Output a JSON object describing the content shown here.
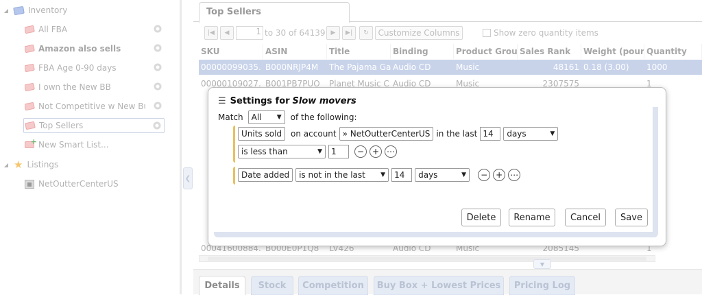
{
  "sidebar": {
    "inventory_label": "Inventory",
    "items": [
      {
        "label": "All FBA"
      },
      {
        "label": "Amazon also sells"
      },
      {
        "label": "FBA Age 0-90 days"
      },
      {
        "label": "I own the New BB"
      },
      {
        "label": "Not Competitive w New Bu"
      },
      {
        "label": "Top Sellers"
      }
    ],
    "new_smart_list": "New Smart List...",
    "listings_label": "Listings",
    "account_item": "NetOutterCenterUS"
  },
  "main": {
    "tab_title": "Top Sellers",
    "pager": {
      "page": "1",
      "range_text": "to 30 of 64139"
    },
    "customize_label": "Customize Columns",
    "show_zero_label": "Show zero quantity items",
    "columns": [
      "SKU",
      "ASIN",
      "Title",
      "Binding",
      "Product Grou",
      "Sales Rank",
      "Weight (pour",
      "Quantity"
    ],
    "rows": [
      {
        "sku": "00000099035.",
        "asin": "B000NRJP4M",
        "title": "The Pajama Ga",
        "binding": "Audio CD",
        "group": "Music",
        "rank": "48161",
        "weight": "0.18 (3.00)",
        "qty": "1000"
      },
      {
        "sku": "00000109027.",
        "asin": "B001PB7PUO",
        "title": "Planet Music C",
        "binding": "Audio CD",
        "group": "Music",
        "rank": "2307575",
        "weight": "",
        "qty": "1"
      },
      {
        "sku": "00041600884.",
        "asin": "B000E0P1Q8",
        "title": "LV426",
        "binding": "Audio CD",
        "group": "Music",
        "rank": "2085145",
        "weight": "",
        "qty": "1"
      }
    ]
  },
  "bottom_tabs": [
    "Details",
    "Stock",
    "Competition",
    "Buy Box + Lowest Prices",
    "Pricing Log"
  ],
  "dialog": {
    "title_prefix": "Settings for",
    "list_name": "Slow movers",
    "match_label": "Match",
    "match_value": "All",
    "of_following": "of the following:",
    "condition1": {
      "field": "Units sold",
      "on_account": "on account",
      "account": "» NetOutterCenterUS",
      "in_last": "in the last",
      "num": "14",
      "unit": "days",
      "operator": "is less than",
      "value": "1"
    },
    "condition2": {
      "field": "Date added",
      "operator": "is not in the last",
      "num": "14",
      "unit": "days"
    },
    "buttons": {
      "delete": "Delete",
      "rename": "Rename",
      "cancel": "Cancel",
      "save": "Save"
    }
  }
}
